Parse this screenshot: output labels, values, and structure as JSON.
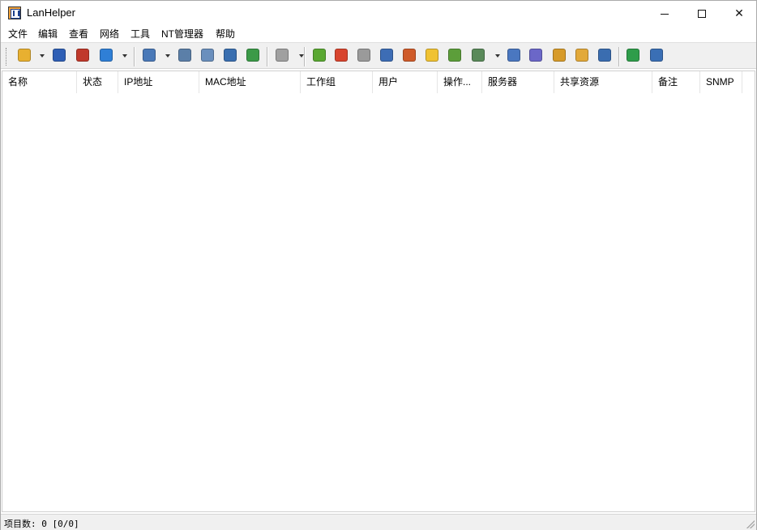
{
  "window": {
    "title": "LanHelper",
    "controls": {
      "minimize": "—",
      "maximize": "☐",
      "close": "✕"
    }
  },
  "menu": {
    "items": [
      {
        "label": "文件"
      },
      {
        "label": "编辑"
      },
      {
        "label": "查看"
      },
      {
        "label": "网络"
      },
      {
        "label": "工具"
      },
      {
        "label": "NT管理器"
      },
      {
        "label": "帮助"
      }
    ]
  },
  "toolbar": {
    "buttons": [
      {
        "icon": "open-folder-icon",
        "color": "#e8b030"
      },
      {
        "icon": "save-icon",
        "color": "#2f5fb5"
      },
      {
        "icon": "delete-icon",
        "color": "#c0392b"
      },
      {
        "icon": "filter-icon",
        "color": "#2f7fd6"
      },
      {
        "icon": "scan-network-icon",
        "color": "#4a79b8"
      },
      {
        "icon": "find-computer-icon",
        "color": "#5b7fa8"
      },
      {
        "icon": "computers-icon",
        "color": "#6a8fbd"
      },
      {
        "icon": "users-icon",
        "color": "#3a6fb0"
      },
      {
        "icon": "add-computer-icon",
        "color": "#3b9a48"
      },
      {
        "icon": "page-icon",
        "color": "#a0a0a0"
      },
      {
        "icon": "wake-icon",
        "color": "#5aa832"
      },
      {
        "icon": "power-icon",
        "color": "#d8442e"
      },
      {
        "icon": "grey-box-icon",
        "color": "#9a9a9a"
      },
      {
        "icon": "info-icon",
        "color": "#3d6db5"
      },
      {
        "icon": "user-icon",
        "color": "#cf5b2a"
      },
      {
        "icon": "folder-icon",
        "color": "#f0c232"
      },
      {
        "icon": "share-icon",
        "color": "#5c9e3a"
      },
      {
        "icon": "window-icon",
        "color": "#5a8a5a"
      },
      {
        "icon": "message-icon",
        "color": "#4a77c0"
      },
      {
        "icon": "settings-icon",
        "color": "#6b67c8"
      },
      {
        "icon": "group-icon",
        "color": "#d79b2a"
      },
      {
        "icon": "open-share-icon",
        "color": "#e2a93a"
      },
      {
        "icon": "user-manage-icon",
        "color": "#3a6db0"
      },
      {
        "icon": "connect-icon",
        "color": "#2e9d4a"
      },
      {
        "icon": "options-icon",
        "color": "#3a6fb5"
      }
    ]
  },
  "list": {
    "columns": [
      {
        "label": "名称"
      },
      {
        "label": "状态"
      },
      {
        "label": "IP地址"
      },
      {
        "label": "MAC地址"
      },
      {
        "label": "工作组"
      },
      {
        "label": "用户"
      },
      {
        "label": "操作..."
      },
      {
        "label": "服务器"
      },
      {
        "label": "共享资源"
      },
      {
        "label": "备注"
      },
      {
        "label": "SNMP"
      }
    ],
    "rows": []
  },
  "status": {
    "text": "项目数: 0 [0/0]"
  }
}
